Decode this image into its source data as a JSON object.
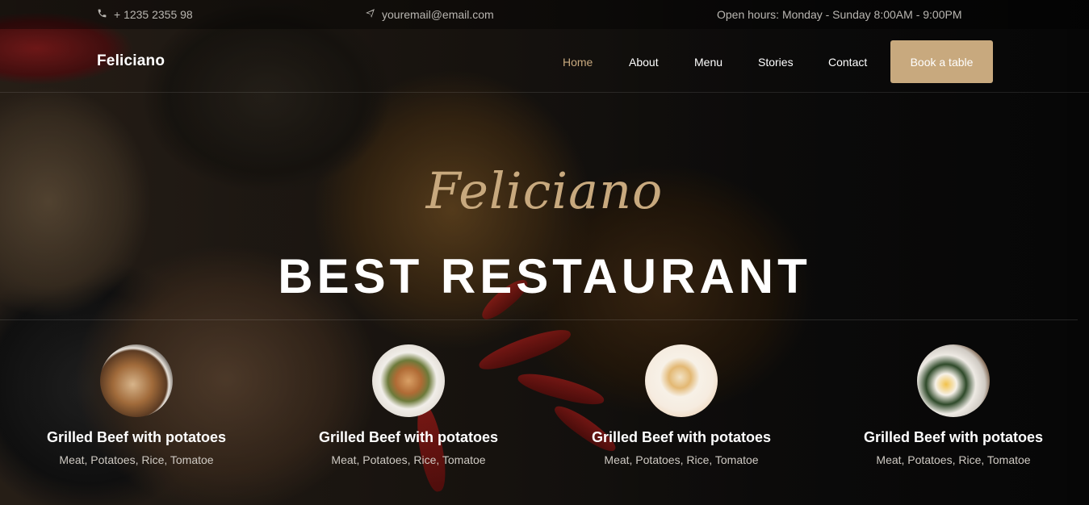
{
  "topbar": {
    "phone": "+ 1235 2355 98",
    "email": "youremail@email.com",
    "hours": "Open hours: Monday - Sunday 8:00AM - 9:00PM"
  },
  "header": {
    "brand": "Feliciano",
    "nav": [
      {
        "label": "Home",
        "active": true
      },
      {
        "label": "About",
        "active": false
      },
      {
        "label": "Menu",
        "active": false
      },
      {
        "label": "Stories",
        "active": false
      },
      {
        "label": "Contact",
        "active": false
      }
    ],
    "cta": "Book a table"
  },
  "hero": {
    "script_title": "Feliciano",
    "title": "BEST RESTAURANT"
  },
  "dishes": [
    {
      "name": "Grilled Beef with potatoes",
      "description": "Meat, Potatoes, Rice, Tomatoe"
    },
    {
      "name": "Grilled Beef with potatoes",
      "description": "Meat, Potatoes, Rice, Tomatoe"
    },
    {
      "name": "Grilled Beef with potatoes",
      "description": "Meat, Potatoes, Rice, Tomatoe"
    },
    {
      "name": "Grilled Beef with potatoes",
      "description": "Meat, Potatoes, Rice, Tomatoe"
    }
  ],
  "icons": {
    "phone": "phone-icon",
    "email": "paper-plane-icon"
  },
  "colors": {
    "accent": "#c8a97e",
    "text": "#ffffff",
    "muted": "#b9b6b1"
  }
}
